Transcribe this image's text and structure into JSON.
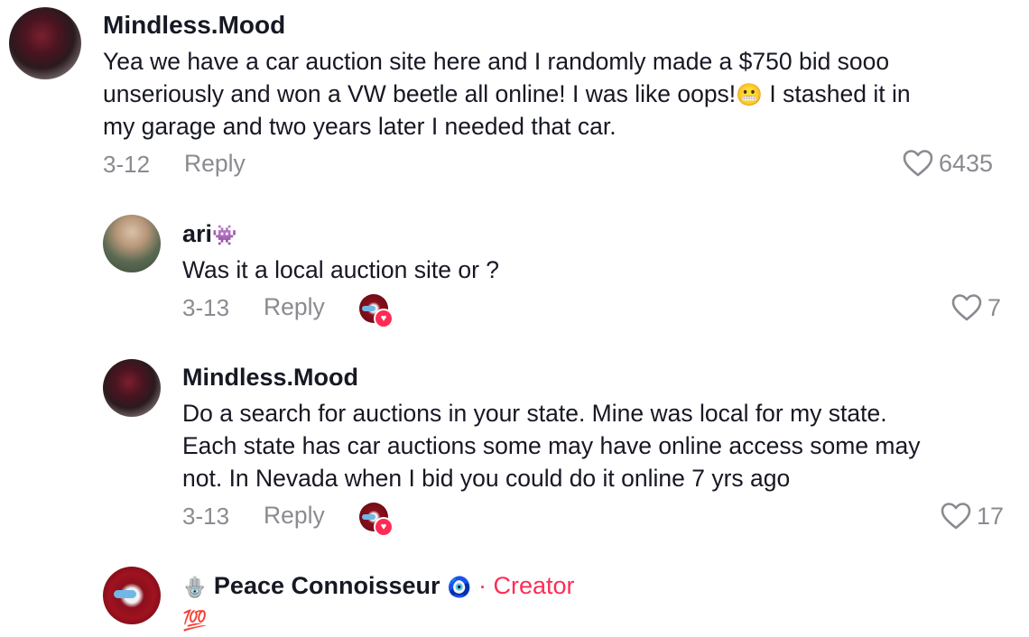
{
  "comments": [
    {
      "author": "Mindless.Mood",
      "lines": [
        "Yea we have a car auction site here and I randomly made a $750 bid sooo",
        "unseriously and won a VW beetle all online! I was like oops!",
        "my garage and two years later I needed that car."
      ],
      "inline_emoji": "😬",
      "line2_tail": " I stashed it in",
      "date": "3-12",
      "reply_label": "Reply",
      "likes": "6435"
    },
    {
      "author": "ari",
      "author_emoji": "👾",
      "lines": [
        "Was it a local auction site or ?"
      ],
      "date": "3-13",
      "reply_label": "Reply",
      "likes": "7"
    },
    {
      "author": "Mindless.Mood",
      "lines": [
        "Do a search for auctions in your state. Mine was local for my state.",
        "Each state has car auctions some may have online access some may",
        "not. In Nevada when I bid you could do it online 7 yrs ago"
      ],
      "date": "3-13",
      "reply_label": "Reply",
      "likes": "17"
    },
    {
      "author": "Peace Connoisseur",
      "author_prefix_emoji": "🪬",
      "author_suffix_emoji": "🧿",
      "separator": "·",
      "badge": "Creator",
      "lines": [
        "💯"
      ]
    }
  ],
  "icons": {
    "like": "heart-outline-icon",
    "creator_liked": "creator-liked-badge"
  },
  "colors": {
    "text": "#161823",
    "muted": "#8a8b91",
    "accent": "#fe2c55"
  }
}
